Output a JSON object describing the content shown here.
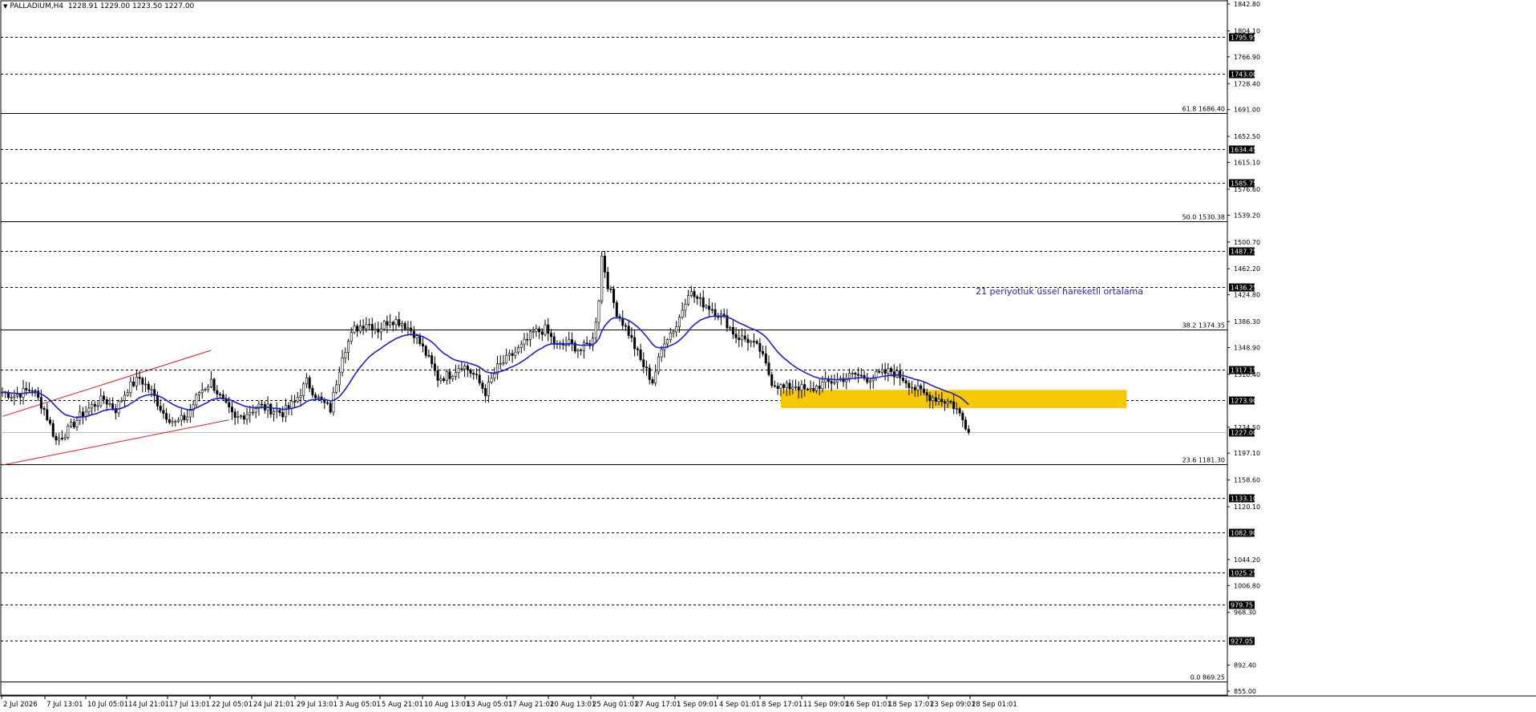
{
  "header": {
    "symbol": "PALLADIUM,H4",
    "ohlc": "1228.91 1229.00 1223.50 1227.00"
  },
  "chart_data": {
    "type": "candlestick",
    "symbol": "PALLADIUM",
    "timeframe": "H4",
    "ylim": [
      855.0,
      1842.8
    ],
    "price_scale_ticks": [
      "1842.80",
      "1804.10",
      "1766.90",
      "1728.40",
      "1691.00",
      "1652.50",
      "1615.10",
      "1576.60",
      "1539.20",
      "1500.70",
      "1462.20",
      "1424.80",
      "1386.30",
      "1348.90",
      "1310.40",
      "1234.50",
      "1197.10",
      "1158.60",
      "1120.10",
      "1044.20",
      "1006.80",
      "968.30",
      "892.40",
      "855.00"
    ],
    "time_labels": [
      "2 Jul 2026",
      "7 Jul 13:01",
      "10 Jul 05:01",
      "14 Jul 21:01",
      "17 Jul 13:01",
      "22 Jul 05:01",
      "24 Jul 21:01",
      "29 Jul 13:01",
      "3 Aug 05:01",
      "5 Aug 21:01",
      "10 Aug 13:01",
      "13 Aug 05:01",
      "17 Aug 21:01",
      "20 Aug 13:01",
      "25 Aug 01:01",
      "27 Aug 17:01",
      "1 Sep 09:01",
      "4 Sep 01:01",
      "8 Sep 17:01",
      "11 Sep 09:01",
      "16 Sep 01:01",
      "18 Sep 17:01",
      "23 Sep 09:01",
      "28 Sep 01:01"
    ],
    "horizontal_levels": [
      {
        "price": 1795.95,
        "label": "1795.95"
      },
      {
        "price": 1743.0,
        "label": "1743.00"
      },
      {
        "price": 1634.45,
        "label": "1634.45"
      },
      {
        "price": 1585.75,
        "label": "1585.75"
      },
      {
        "price": 1487.75,
        "label": "1487.75"
      },
      {
        "price": 1436.25,
        "label": "1436.25"
      },
      {
        "price": 1317.15,
        "label": "1317.15"
      },
      {
        "price": 1273.9,
        "label": "1273.90"
      },
      {
        "price": 1133.1,
        "label": "1133.10"
      },
      {
        "price": 1082.9,
        "label": "1082.90"
      },
      {
        "price": 1025.25,
        "label": "1025.25"
      },
      {
        "price": 979.75,
        "label": "979.75"
      },
      {
        "price": 927.05,
        "label": "927.05"
      }
    ],
    "fibonacci_levels": [
      {
        "price": 1686.4,
        "label": "61.8 1686.40"
      },
      {
        "price": 1530.38,
        "label": "50.0 1530.38"
      },
      {
        "price": 1374.35,
        "label": "38.2 1374.35"
      },
      {
        "price": 1181.3,
        "label": "23.6 1181.30"
      },
      {
        "price": 869.25,
        "label": "0.0 869.25"
      }
    ],
    "current_price": {
      "price": 1227.0,
      "label": "1227.00"
    },
    "ema_annotation": "21 periyotluk üssel hareketli ortalama",
    "ema_period": 21,
    "colors": {
      "ema": "#1f1fd6",
      "channel": "#d42020",
      "highlight_zone": "#f5c800",
      "grid": "#000000",
      "annotation_text": "#1f1fd6"
    },
    "highlight_zone": {
      "price_top": 1288,
      "price_bottom": 1262,
      "from_label": "8 Sep 17:01"
    },
    "price_waypoints": [
      [
        0,
        1285
      ],
      [
        4,
        1280
      ],
      [
        10,
        1290
      ],
      [
        14,
        1260
      ],
      [
        18,
        1215
      ],
      [
        22,
        1230
      ],
      [
        26,
        1250
      ],
      [
        30,
        1265
      ],
      [
        34,
        1275
      ],
      [
        38,
        1260
      ],
      [
        42,
        1290
      ],
      [
        46,
        1305
      ],
      [
        50,
        1285
      ],
      [
        54,
        1255
      ],
      [
        58,
        1240
      ],
      [
        62,
        1250
      ],
      [
        66,
        1285
      ],
      [
        70,
        1300
      ],
      [
        74,
        1270
      ],
      [
        78,
        1245
      ],
      [
        82,
        1255
      ],
      [
        86,
        1265
      ],
      [
        90,
        1260
      ],
      [
        94,
        1255
      ],
      [
        98,
        1270
      ],
      [
        102,
        1300
      ],
      [
        106,
        1275
      ],
      [
        110,
        1260
      ],
      [
        114,
        1340
      ],
      [
        118,
        1375
      ],
      [
        122,
        1385
      ],
      [
        126,
        1375
      ],
      [
        130,
        1390
      ],
      [
        134,
        1385
      ],
      [
        138,
        1370
      ],
      [
        142,
        1340
      ],
      [
        146,
        1305
      ],
      [
        150,
        1310
      ],
      [
        154,
        1325
      ],
      [
        158,
        1310
      ],
      [
        162,
        1285
      ],
      [
        166,
        1320
      ],
      [
        170,
        1335
      ],
      [
        174,
        1350
      ],
      [
        178,
        1370
      ],
      [
        182,
        1375
      ],
      [
        186,
        1350
      ],
      [
        190,
        1355
      ],
      [
        194,
        1345
      ],
      [
        198,
        1360
      ],
      [
        200,
        1420
      ],
      [
        201,
        1480
      ],
      [
        203,
        1440
      ],
      [
        206,
        1400
      ],
      [
        210,
        1370
      ],
      [
        214,
        1330
      ],
      [
        218,
        1300
      ],
      [
        222,
        1360
      ],
      [
        226,
        1380
      ],
      [
        230,
        1430
      ],
      [
        234,
        1415
      ],
      [
        238,
        1405
      ],
      [
        242,
        1390
      ],
      [
        246,
        1365
      ],
      [
        250,
        1360
      ],
      [
        254,
        1345
      ],
      [
        258,
        1300
      ],
      [
        262,
        1290
      ],
      [
        266,
        1295
      ],
      [
        270,
        1285
      ],
      [
        274,
        1295
      ],
      [
        278,
        1300
      ],
      [
        282,
        1305
      ],
      [
        286,
        1310
      ],
      [
        290,
        1305
      ],
      [
        294,
        1310
      ],
      [
        298,
        1315
      ],
      [
        302,
        1305
      ],
      [
        306,
        1290
      ],
      [
        310,
        1280
      ],
      [
        314,
        1275
      ],
      [
        318,
        1270
      ],
      [
        320,
        1260
      ],
      [
        322,
        1245
      ],
      [
        324,
        1230
      ]
    ],
    "channel_lines": [
      {
        "from": [
          0,
          1250
        ],
        "to": [
          70,
          1345
        ]
      },
      {
        "from": [
          0,
          1180
        ],
        "to": [
          76,
          1245
        ]
      }
    ]
  }
}
